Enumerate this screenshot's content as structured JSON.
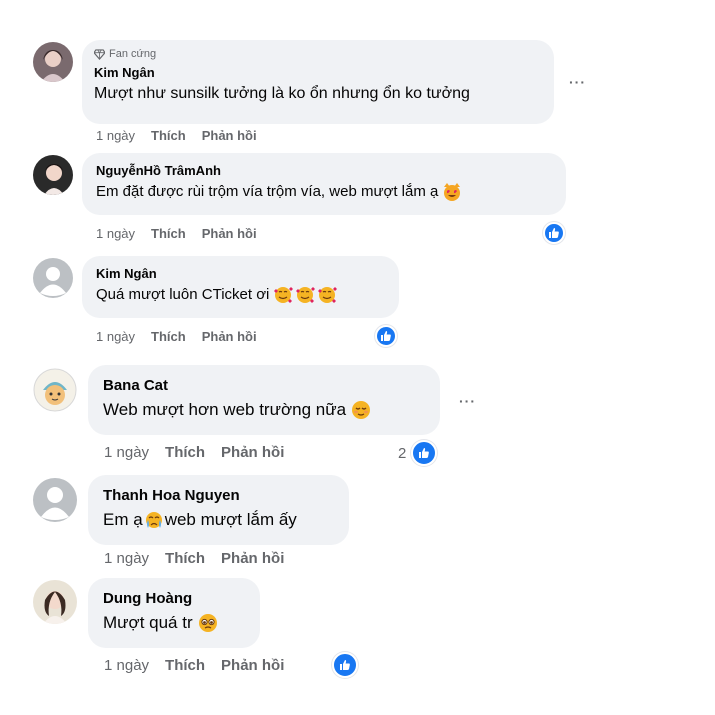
{
  "comments": [
    {
      "badge": "Fan cứng",
      "author": "Kim Ngân",
      "text": "Mượt như sunsilk tưởng là ko ổn nhưng ổn ko tưởng",
      "time": "1 ngày",
      "like_label": "Thích",
      "reply_label": "Phản hồi",
      "more_label": "···",
      "reaction_icon": "none"
    },
    {
      "author": "NguyễnHồ TrâmAnh",
      "text": "Em đặt được rùi trộm vía trộm vía, web mượt lắm ạ",
      "emoji": "heart-eyes-cat-emoji",
      "time": "1 ngày",
      "like_label": "Thích",
      "reply_label": "Phản hồi",
      "reaction_icon": "like-icon"
    },
    {
      "author": "Kim Ngân",
      "text": "Quá mượt luôn CTicket ơi",
      "emoji": "smiling-face-with-hearts-emoji x3",
      "time": "1 ngày",
      "like_label": "Thích",
      "reply_label": "Phản hồi",
      "reaction_icon": "like-icon"
    },
    {
      "author": "Bana Cat",
      "text": "Web mượt hơn web trường nữa",
      "emoji": "relieved-face-emoji",
      "time": "1 ngày",
      "like_label": "Thích",
      "reply_label": "Phản hồi",
      "more_label": "···",
      "reaction_count": "2",
      "reaction_icon": "like-icon"
    },
    {
      "author": "Thanh Hoa Nguyen",
      "text_before": "Em ạ",
      "text_after": "web mượt lắm ấy",
      "emoji": "crying-face-emoji",
      "time": "1 ngày",
      "like_label": "Thích",
      "reply_label": "Phản hồi",
      "reaction_icon": "none"
    },
    {
      "author": "Dung Hoàng",
      "text": "Mượt quá tr",
      "emoji": "pleading-face-emoji",
      "time": "1 ngày",
      "like_label": "Thích",
      "reply_label": "Phản hồi",
      "reaction_icon": "like-icon"
    }
  ],
  "colors": {
    "bubble": "#f0f2f5",
    "secondary_text": "#65676b",
    "like_blue": "#1877f2"
  }
}
